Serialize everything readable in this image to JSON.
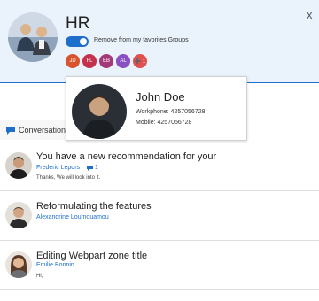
{
  "group": {
    "title": "HR",
    "favorite_toggle_label": "Remove from my favorites Groups",
    "close_glyph": "x",
    "members": [
      {
        "initials": "JD",
        "color": "#d9532c"
      },
      {
        "initials": "FL",
        "color": "#c4314b"
      },
      {
        "initials": "EB",
        "color": "#a4397a"
      },
      {
        "initials": "AL",
        "color": "#8a4fc0"
      },
      {
        "initials": "➕ 1",
        "color": "#e0504f"
      }
    ]
  },
  "contact_card": {
    "name": "John Doe",
    "workphone": "Workphone: 4257056728",
    "mobile": "Mobile: 4257056728"
  },
  "tab": {
    "label": "Conversation"
  },
  "conversations": [
    {
      "title": "You have a new recommendation for your",
      "author": "Frederic Lepors",
      "reply_count": "1",
      "snippet": "Thanks, We will look into it."
    },
    {
      "title": "Reformulating the features",
      "author": "Alexandrine Loumouamou",
      "snippet": ""
    },
    {
      "title": "Editing Webpart zone title",
      "author": "Emilie Bonnin",
      "snippet": "Hi,"
    }
  ]
}
